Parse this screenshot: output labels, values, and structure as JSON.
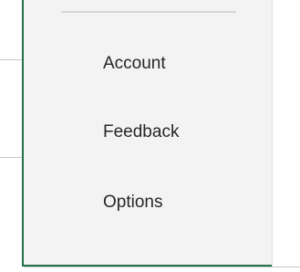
{
  "backstage_nav": {
    "items": [
      {
        "label": "Account"
      },
      {
        "label": "Feedback"
      },
      {
        "label": "Options"
      }
    ]
  },
  "colors": {
    "accent": "#217346",
    "panel_bg": "#f3f3f3",
    "text": "#262626"
  }
}
